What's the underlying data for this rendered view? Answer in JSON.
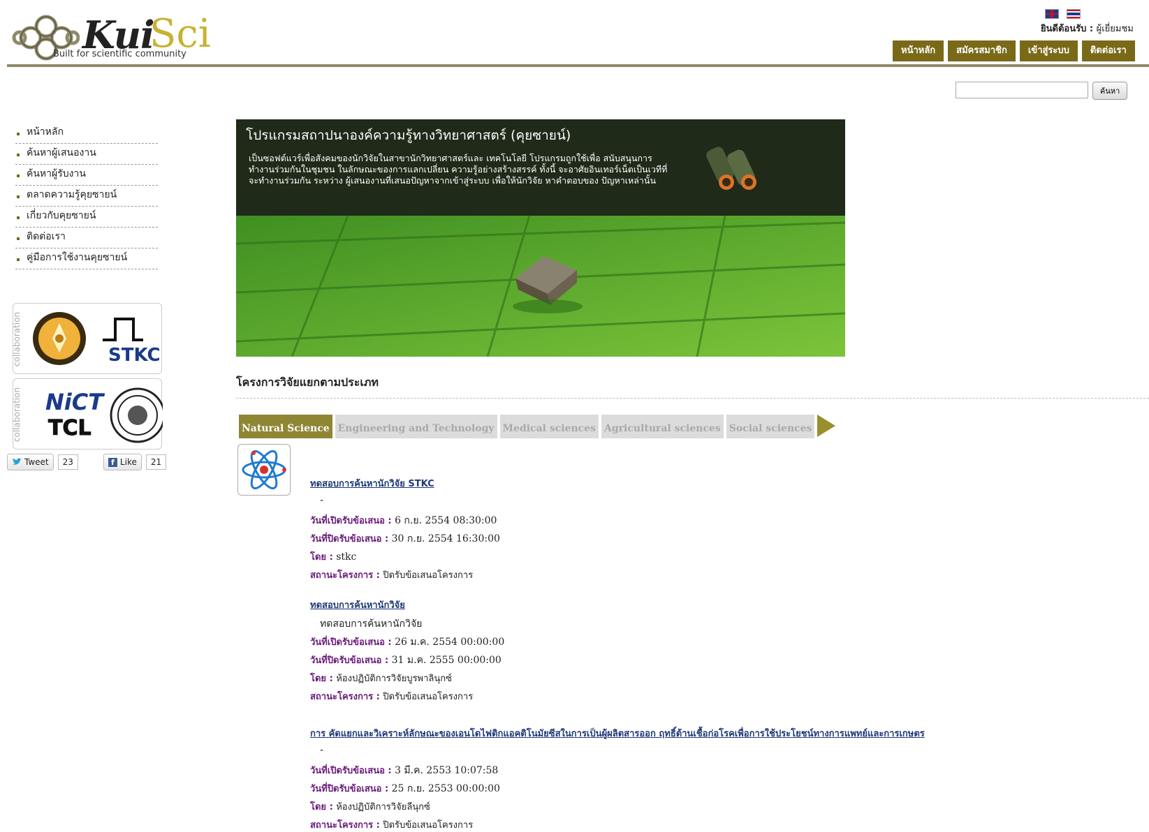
{
  "header": {
    "brand_main": "Kui",
    "brand_accent": "Sci",
    "tagline": "Built for scientific community",
    "welcome_label": "ยินดีต้อนรับ :",
    "welcome_user": "ผู้เยี่ยมชม",
    "nav": [
      "หน้าหลัก",
      "สมัครสมาชิก",
      "เข้าสู่ระบบ",
      "ติดต่อเรา"
    ]
  },
  "search": {
    "button_label": "ค้นหา",
    "value": ""
  },
  "sidebar": {
    "items": [
      {
        "label": "หน้าหลัก"
      },
      {
        "label": "ค้นหาผู้เสนองาน"
      },
      {
        "label": "ค้นหาผู้รับงาน"
      },
      {
        "label": "ตลาดความรู้คุยซายน์"
      },
      {
        "label": "เกี่ยวกับคุยซายน์"
      },
      {
        "label": "ติดต่อเรา"
      },
      {
        "label": "คู่มือการใช้งานคุยซายน์"
      }
    ],
    "collab_label": "collaboration",
    "logos": [
      "STKC",
      "NiCT",
      "TCL"
    ]
  },
  "social": {
    "tweet_label": "Tweet",
    "tweet_count": "23",
    "like_label": "Like",
    "like_count": "21"
  },
  "banner": {
    "title": "โปรแกรมสถาปนาองค์ความรู้ทางวิทยาศาสตร์ (คุยซายน์)",
    "description": "เป็นซอฟต์แวร์เพื่อสังคมของนักวิจัยในสาขานักวิทยาศาสตร์และ เทคโนโลยี โปรแกรมถูกใช้เพื่อ สนับสนุนการทำงานร่วมกันในชุมชน ในลักษณะของการแลกเปลี่ยน ความรู้อย่างสร้างสรรค์ ทั้งนี้ จะอาศัยอินเทอร์เน็ตเป็นเวทีที่จะทำงานร่วมกัน ระหว่าง ผู้เสนองานที่เสนอปัญหาจากเข้าสู่ระบบ เพื่อให้นักวิจัย หาคำตอบของ ปัญหาเหล่านั้น"
  },
  "categories": {
    "heading": "โครงการวิจัยแยกตามประเภท",
    "tabs": [
      "Natural Science",
      "Engineering and Technology",
      "Medical sciences",
      "Agricultural sciences",
      "Social sciences"
    ],
    "active_index": 0
  },
  "projects": [
    {
      "title": "ทดสอบการค้นหานักวิจัย STKC",
      "description": "-",
      "open_label": "วันที่เปิดรับข้อเสนอ :",
      "open_value": "6 ก.ย. 2554 08:30:00",
      "close_label": "วันที่ปิดรับข้อเสนอ :",
      "close_value": "30 ก.ย. 2554 16:30:00",
      "by_label": "โดย :",
      "by_value": "stkc",
      "status_label": "สถานะโครงการ :",
      "status_value": "ปิดรับข้อเสนอโครงการ"
    },
    {
      "title": "ทดสอบการค้นหานักวิจัย",
      "description": "ทดสอบการค้นหานักวิจัย",
      "open_label": "วันที่เปิดรับข้อเสนอ :",
      "open_value": "26 ม.ค. 2554 00:00:00",
      "close_label": "วันที่ปิดรับข้อเสนอ :",
      "close_value": "31 ม.ค. 2555 00:00:00",
      "by_label": "โดย :",
      "by_value": "ห้องปฏิบัติการวิจัยบูรพาลินุกซ์",
      "status_label": "สถานะโครงการ :",
      "status_value": "ปิดรับข้อเสนอโครงการ"
    },
    {
      "title": "การ คัดแยกและวิเคราะห์ลักษณะของเอนโดไฟติกแอคติโนมัยซีสในการเป็นผู้ผลิตสารออก ฤทธิ์ต้านเชื้อก่อโรคเพื่อการใช้ประโยชน์ทางการแพทย์และการเกษตร",
      "description": "-",
      "open_label": "วันที่เปิดรับข้อเสนอ :",
      "open_value": "3 มี.ค. 2553 10:07:58",
      "close_label": "วันที่ปิดรับข้อเสนอ :",
      "close_value": "25 ก.ย. 2553 00:00:00",
      "by_label": "โดย :",
      "by_value": "ห้องปฏิบัติการวิจัยลีนุกซ์",
      "status_label": "สถานะโครงการ :",
      "status_value": "ปิดรับข้อเสนอโครงการ"
    }
  ],
  "colors": {
    "nav_bg": "#7a6a18",
    "active_tab": "#8f8634",
    "link": "#1f3a78",
    "field_label": "#6a1b7a"
  }
}
